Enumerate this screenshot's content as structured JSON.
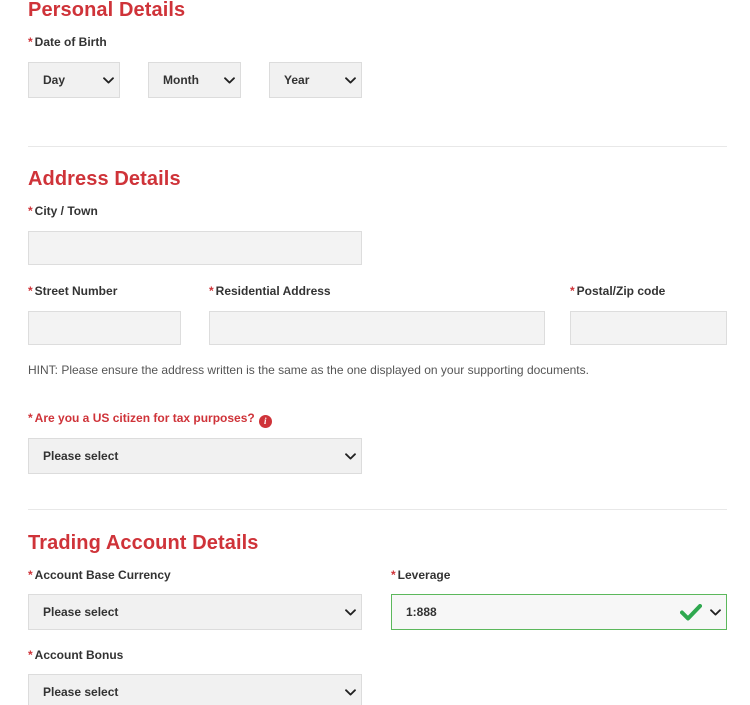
{
  "sections": [
    {
      "title": "Personal Details",
      "fields": [
        {
          "label": "Date of Birth",
          "required": true
        }
      ],
      "selects": [
        {
          "value": "Day"
        },
        {
          "value": "Month"
        },
        {
          "value": "Year"
        }
      ]
    },
    {
      "title": "Address Details",
      "fields": [
        {
          "label": "City / Town",
          "required": true
        },
        {
          "label": "Street Number",
          "required": true
        },
        {
          "label": "Residential Address",
          "required": true
        },
        {
          "label": "Postal/Zip code",
          "required": true
        },
        {
          "label": "Are you a US citizen for tax purposes?",
          "required": true
        }
      ],
      "hint": "HINT: Please ensure the address written is the same as the one displayed on your supporting documents.",
      "us_citizen_select": {
        "value": "Please select"
      }
    },
    {
      "title": "Trading Account Details",
      "fields": [
        {
          "label": "Account Base Currency",
          "required": true
        },
        {
          "label": "Leverage",
          "required": true
        },
        {
          "label": "Account Bonus",
          "required": true
        }
      ],
      "selects": [
        {
          "value": "Please select"
        },
        {
          "value": "1:888",
          "valid": true
        },
        {
          "value": "Please select"
        }
      ]
    }
  ],
  "text_inputs": {
    "city_town": {
      "value": "",
      "placeholder": ""
    },
    "street_number": {
      "value": "",
      "placeholder": ""
    },
    "residential_address": {
      "value": "",
      "placeholder": ""
    },
    "postal_zip": {
      "value": "",
      "placeholder": ""
    }
  },
  "labels": {
    "required_marker": "*",
    "date_of_birth": "Date of Birth",
    "city_town": "City / Town",
    "street_number": "Street Number",
    "residential_address": "Residential Address",
    "postal_zip": "Postal/Zip code",
    "us_citizen": "Are you a US citizen for tax purposes?",
    "account_base_currency": "Account Base Currency",
    "leverage": "Leverage",
    "account_bonus": "Account Bonus"
  },
  "headings": {
    "personal_details": "Personal Details",
    "address_details": "Address Details",
    "trading_account_details": "Trading Account Details"
  },
  "values": {
    "day": "Day",
    "month": "Month",
    "year": "Year",
    "us_citizen": "Please select",
    "account_base_currency": "Please select",
    "leverage": "1:888",
    "account_bonus": "Please select"
  },
  "hint_text": "HINT: Please ensure the address written is the same as the one displayed on your supporting documents.",
  "colors": {
    "heading_red": "#cf3339",
    "required_red": "#cf3339",
    "valid_green": "#5cb85c",
    "input_bg": "#f3f3f3",
    "select_bg": "#f1f1f1"
  }
}
